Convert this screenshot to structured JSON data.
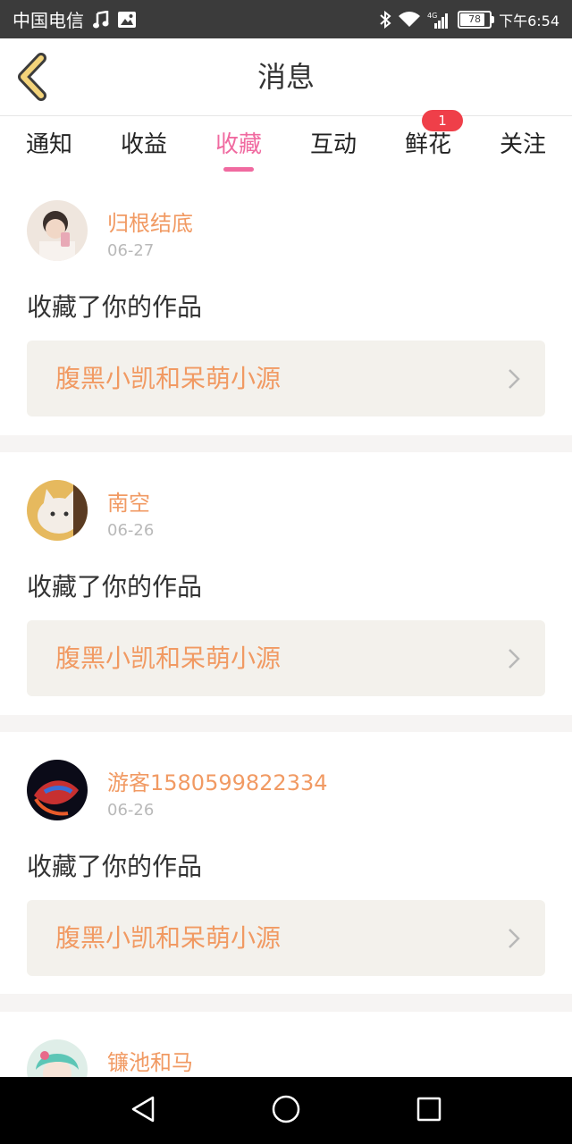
{
  "status_bar": {
    "carrier": "中国电信",
    "time": "下午6:54",
    "battery": "78",
    "network": "4G",
    "icons": [
      "music-icon",
      "image-icon",
      "bluetooth-icon",
      "wifi-icon",
      "signal-icon",
      "battery-icon"
    ]
  },
  "header": {
    "title": "消息",
    "back_icon": "chevron-left-icon"
  },
  "tabs": [
    {
      "label": "通知"
    },
    {
      "label": "收益"
    },
    {
      "label": "收藏",
      "active": true
    },
    {
      "label": "互动"
    },
    {
      "label": "鲜花",
      "badge": "1"
    },
    {
      "label": "关注"
    }
  ],
  "feed": {
    "items": [
      {
        "name": "归根结底",
        "date": "06-27",
        "action": "收藏了你的作品",
        "work": "腹黑小凯和呆萌小源"
      },
      {
        "name": "南空",
        "date": "06-26",
        "action": "收藏了你的作品",
        "work": "腹黑小凯和呆萌小源"
      },
      {
        "name": "游客15805998223​34",
        "date": "06-26",
        "action": "收藏了你的作品",
        "work": "腹黑小凯和呆萌小源"
      },
      {
        "name": "镰池和马",
        "date": "",
        "action": "",
        "work": ""
      }
    ]
  },
  "colors": {
    "accent_pink": "#f06aa0",
    "name_orange": "#f19a63",
    "badge_red": "#ef3f49",
    "status_bar": "#3b3b3b",
    "work_box_bg": "#f3f1ec"
  },
  "nav": {
    "icons": [
      "back-triangle-icon",
      "home-circle-icon",
      "recents-square-icon"
    ]
  }
}
